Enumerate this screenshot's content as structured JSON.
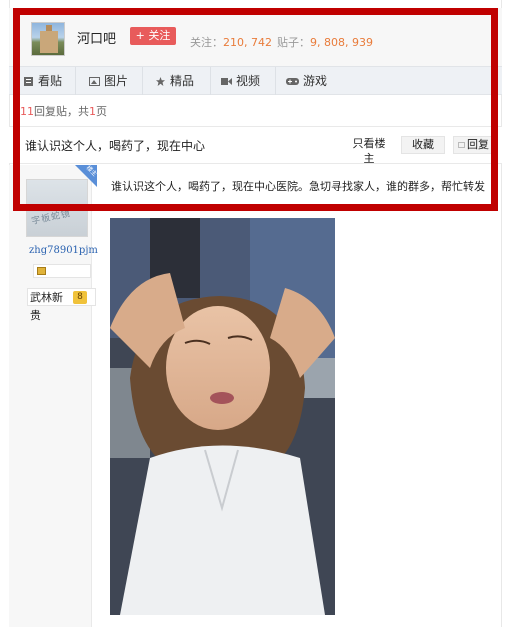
{
  "forum": {
    "name": "河口吧",
    "follow_label": "+ 关注",
    "follow_count_label": "关注：",
    "follow_count": "210, 742",
    "post_count_label": "贴子：",
    "post_count": "9, 808, 939"
  },
  "tabs": [
    {
      "label": "看贴",
      "icon": "doc-icon"
    },
    {
      "label": "图片",
      "icon": "picture-icon"
    },
    {
      "label": "精品",
      "icon": "star-icon"
    },
    {
      "label": "视频",
      "icon": "video-camera-icon"
    },
    {
      "label": "游戏",
      "icon": "gamepad-icon"
    }
  ],
  "reply_info": {
    "count": "11",
    "reply_text": "回复贴，共",
    "pages": "1",
    "page_unit": "页"
  },
  "thread": {
    "title": "谁认识这个人，喝药了，现在中心",
    "only_owner_label": "只看楼主",
    "favorite_label": "收藏",
    "reply_label": "回复"
  },
  "post": {
    "author": "zhg78901pjm",
    "rank_title": "武林新贵",
    "rank_level": "8",
    "avatar_text": "字板蛇镜",
    "corner_badge": "楼主",
    "body": "谁认识这个人，喝药了，现在中心医院。急切寻找家人，谁的群多，帮忙转发"
  },
  "colors": {
    "annotation_red": "#c00000",
    "follow_red": "#e85b5b",
    "count_orange": "#e97c3b",
    "author_blue": "#2a62b0"
  }
}
